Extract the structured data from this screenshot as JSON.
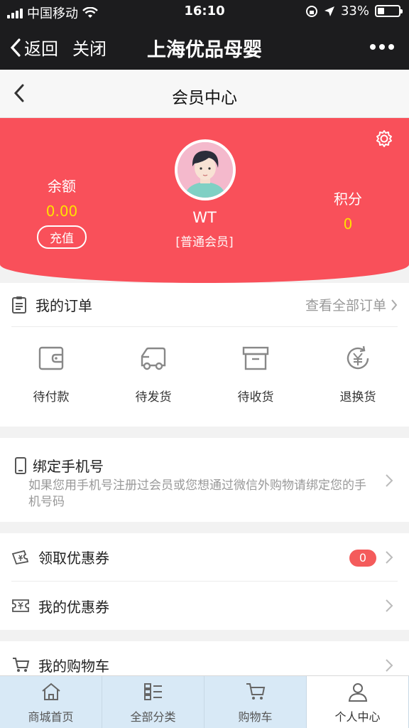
{
  "status_bar": {
    "carrier": "中国移动",
    "time": "16:10",
    "battery": "33%",
    "battery_level": 0.33
  },
  "nav": {
    "back_label": "返回",
    "close_label": "关闭",
    "title": "上海优品母婴"
  },
  "subheader": {
    "title": "会员中心"
  },
  "profile": {
    "balance_label": "余额",
    "balance_value": "0.00",
    "recharge_label": "充值",
    "username": "WT",
    "level": "[普通会员]",
    "points_label": "积分",
    "points_value": "0"
  },
  "orders": {
    "title": "我的订单",
    "view_all": "查看全部订单",
    "items": [
      {
        "label": "待付款",
        "icon": "wallet-icon"
      },
      {
        "label": "待发货",
        "icon": "truck-icon"
      },
      {
        "label": "待收货",
        "icon": "box-icon"
      },
      {
        "label": "退换货",
        "icon": "refund-icon"
      }
    ]
  },
  "bind_phone": {
    "title": "绑定手机号",
    "description": "如果您用手机号注册过会员或您想通过微信外购物请绑定您的手机号码"
  },
  "coupons": {
    "claim_label": "领取优惠券",
    "claim_count": "0",
    "my_label": "我的优惠券"
  },
  "cart": {
    "label": "我的购物车"
  },
  "tabbar": {
    "items": [
      {
        "label": "商城首页",
        "icon": "home-icon"
      },
      {
        "label": "全部分类",
        "icon": "category-icon"
      },
      {
        "label": "购物车",
        "icon": "cart-icon"
      },
      {
        "label": "个人中心",
        "icon": "user-icon"
      }
    ]
  },
  "colors": {
    "brand_red": "#f9505a",
    "highlight_yellow": "#ffe100",
    "tab_bg": "#d8e9f6"
  }
}
